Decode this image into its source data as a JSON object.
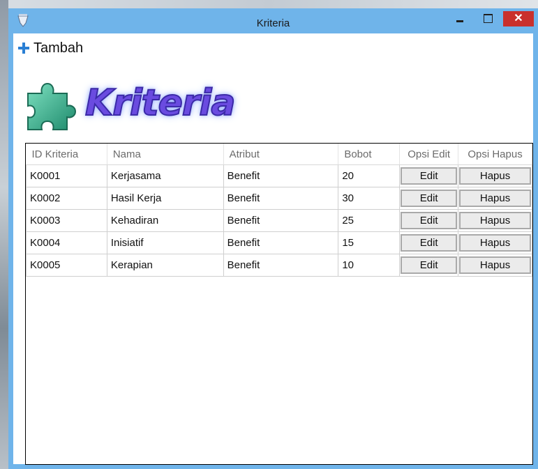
{
  "window": {
    "title": "Kriteria",
    "close_glyph": "✕"
  },
  "toolbar": {
    "add_label": "Tambah"
  },
  "banner": {
    "title": "Kriteria",
    "icon": "puzzle-piece-icon",
    "colors": {
      "text": "#6a4be0",
      "icon": "#2fa386"
    }
  },
  "table": {
    "columns": [
      "ID Kriteria",
      "Nama",
      "Atribut",
      "Bobot",
      "Opsi Edit",
      "Opsi Hapus"
    ],
    "rows": [
      {
        "id": "K0001",
        "nama": "Kerjasama",
        "atribut": "Benefit",
        "bobot": "20",
        "edit": "Edit",
        "hapus": "Hapus"
      },
      {
        "id": "K0002",
        "nama": "Hasil Kerja",
        "atribut": "Benefit",
        "bobot": "30",
        "edit": "Edit",
        "hapus": "Hapus"
      },
      {
        "id": "K0003",
        "nama": "Kehadiran",
        "atribut": "Benefit",
        "bobot": "25",
        "edit": "Edit",
        "hapus": "Hapus"
      },
      {
        "id": "K0004",
        "nama": "Inisiatif",
        "atribut": "Benefit",
        "bobot": "15",
        "edit": "Edit",
        "hapus": "Hapus"
      },
      {
        "id": "K0005",
        "nama": "Kerapian",
        "atribut": "Benefit",
        "bobot": "10",
        "edit": "Edit",
        "hapus": "Hapus"
      }
    ]
  },
  "colors": {
    "titlebar": "#6fb4ea",
    "close": "#c9302c",
    "plus": "#2a7fd4"
  }
}
